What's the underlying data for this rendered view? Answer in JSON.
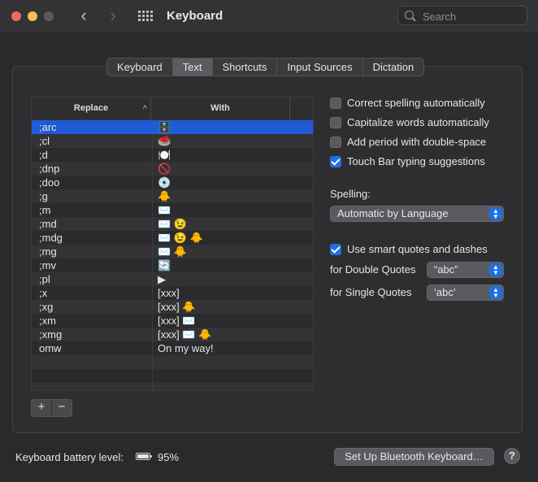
{
  "window": {
    "title": "Keyboard"
  },
  "search": {
    "placeholder": "Search"
  },
  "tabs": [
    {
      "label": "Keyboard",
      "selected": false
    },
    {
      "label": "Text",
      "selected": true
    },
    {
      "label": "Shortcuts",
      "selected": false
    },
    {
      "label": "Input Sources",
      "selected": false
    },
    {
      "label": "Dictation",
      "selected": false
    }
  ],
  "table": {
    "headers": {
      "replace": "Replace",
      "with": "With"
    },
    "rows": [
      {
        "replace": ";arc",
        "with": "🗄️",
        "selected": true
      },
      {
        "replace": ";cl",
        "with": "🥌"
      },
      {
        "replace": ";d",
        "with": "🍽️"
      },
      {
        "replace": ";dnp",
        "with": "🚫"
      },
      {
        "replace": ";doo",
        "with": "💿"
      },
      {
        "replace": ";g",
        "with": "🐥"
      },
      {
        "replace": ";m",
        "with": "✉️"
      },
      {
        "replace": ";md",
        "with": "✉️ 😉"
      },
      {
        "replace": ";mdg",
        "with": "✉️ 😉 🐥"
      },
      {
        "replace": ";mg",
        "with": "✉️ 🐥"
      },
      {
        "replace": ";mv",
        "with": "🔄"
      },
      {
        "replace": ";pl",
        "with": "▶"
      },
      {
        "replace": ";x",
        "with": "[xxx]"
      },
      {
        "replace": ";xg",
        "with": "[xxx] 🐥"
      },
      {
        "replace": ";xm",
        "with": "[xxx] ✉️"
      },
      {
        "replace": ";xmg",
        "with": "[xxx] ✉️ 🐥"
      },
      {
        "replace": "omw",
        "with": "On my way!"
      },
      {
        "replace": "",
        "with": ""
      },
      {
        "replace": "",
        "with": ""
      },
      {
        "replace": "",
        "with": ""
      }
    ]
  },
  "buttons": {
    "add": "+",
    "remove": "−"
  },
  "options": {
    "correct_spelling": {
      "label": "Correct spelling automatically",
      "checked": false
    },
    "capitalize": {
      "label": "Capitalize words automatically",
      "checked": false
    },
    "add_period": {
      "label": "Add period with double-space",
      "checked": false
    },
    "touch_bar": {
      "label": "Touch Bar typing suggestions",
      "checked": true
    },
    "smart_quotes": {
      "label": "Use smart quotes and dashes",
      "checked": true
    }
  },
  "spelling": {
    "label": "Spelling:",
    "value": "Automatic by Language"
  },
  "double_quotes": {
    "label": "for Double Quotes",
    "value": "“abc”"
  },
  "single_quotes": {
    "label": "for Single Quotes",
    "value": "‘abc’"
  },
  "battery": {
    "label": "Keyboard battery level:",
    "percent": "95%",
    "level": 0.95
  },
  "bluetooth_button": "Set Up Bluetooth Keyboard…",
  "help": "?"
}
